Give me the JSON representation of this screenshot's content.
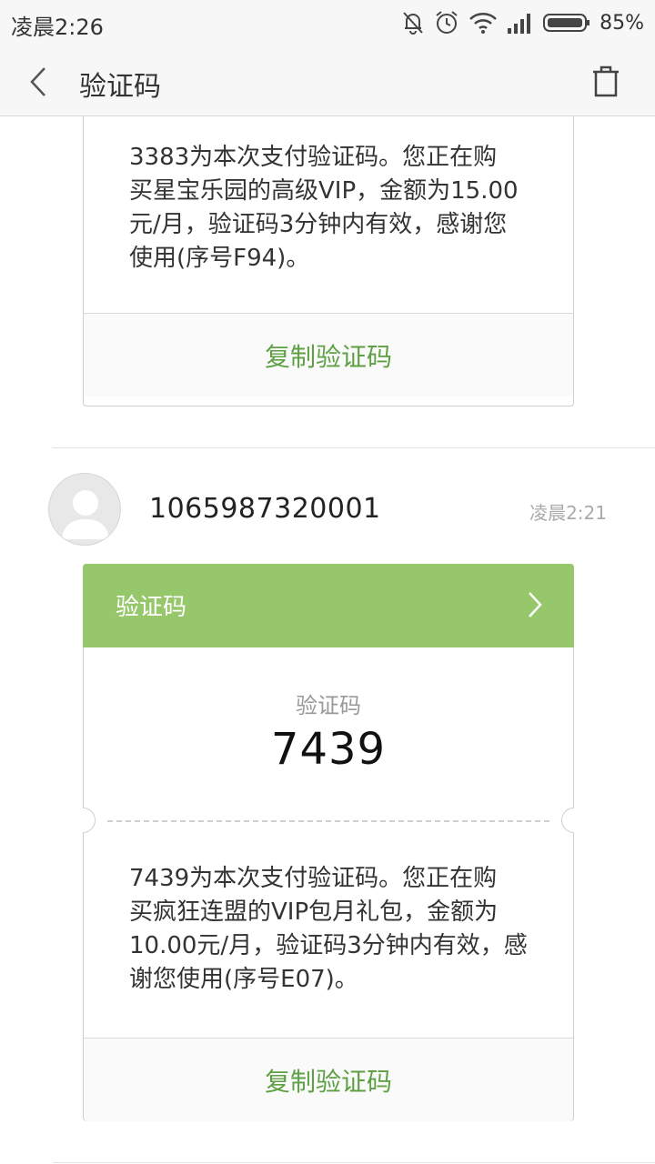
{
  "status_bar": {
    "time": "凌晨2:26",
    "battery_percent": "85%",
    "icons": [
      "mute-bell-icon",
      "alarm-icon",
      "wifi-icon",
      "signal-icon",
      "battery-icon"
    ]
  },
  "header": {
    "title": "验证码",
    "back_icon": "chevron-left-icon",
    "delete_icon": "trash-icon"
  },
  "messages": [
    {
      "body": "3383为本次支付验证码。您正在购买星宝乐园的高级VIP，金额为15.00元/月，验证码3分钟内有效，感谢您使用(序号F94)。",
      "body_lines": [
        "3383为本次支付验证码。您正在购",
        "买星宝乐园的高级VIP，金额为15.00",
        "元/月，验证码3分钟内有效，感谢您",
        "使用(序号F94)。"
      ],
      "copy_label": "复制验证码"
    },
    {
      "sender": "1065987320001",
      "time": "凌晨2:21",
      "band_label": "验证码",
      "code_label": "验证码",
      "code": "7439",
      "body_lines": [
        "7439为本次支付验证码。您正在购",
        "买疯狂连盟的VIP包月礼包，金额为",
        "10.00元/月，验证码3分钟内有效，感",
        "谢您使用(序号E07)。"
      ],
      "copy_label": "复制验证码"
    }
  ],
  "colors": {
    "accent_green": "#96c76b",
    "copy_green": "#5ea044"
  }
}
